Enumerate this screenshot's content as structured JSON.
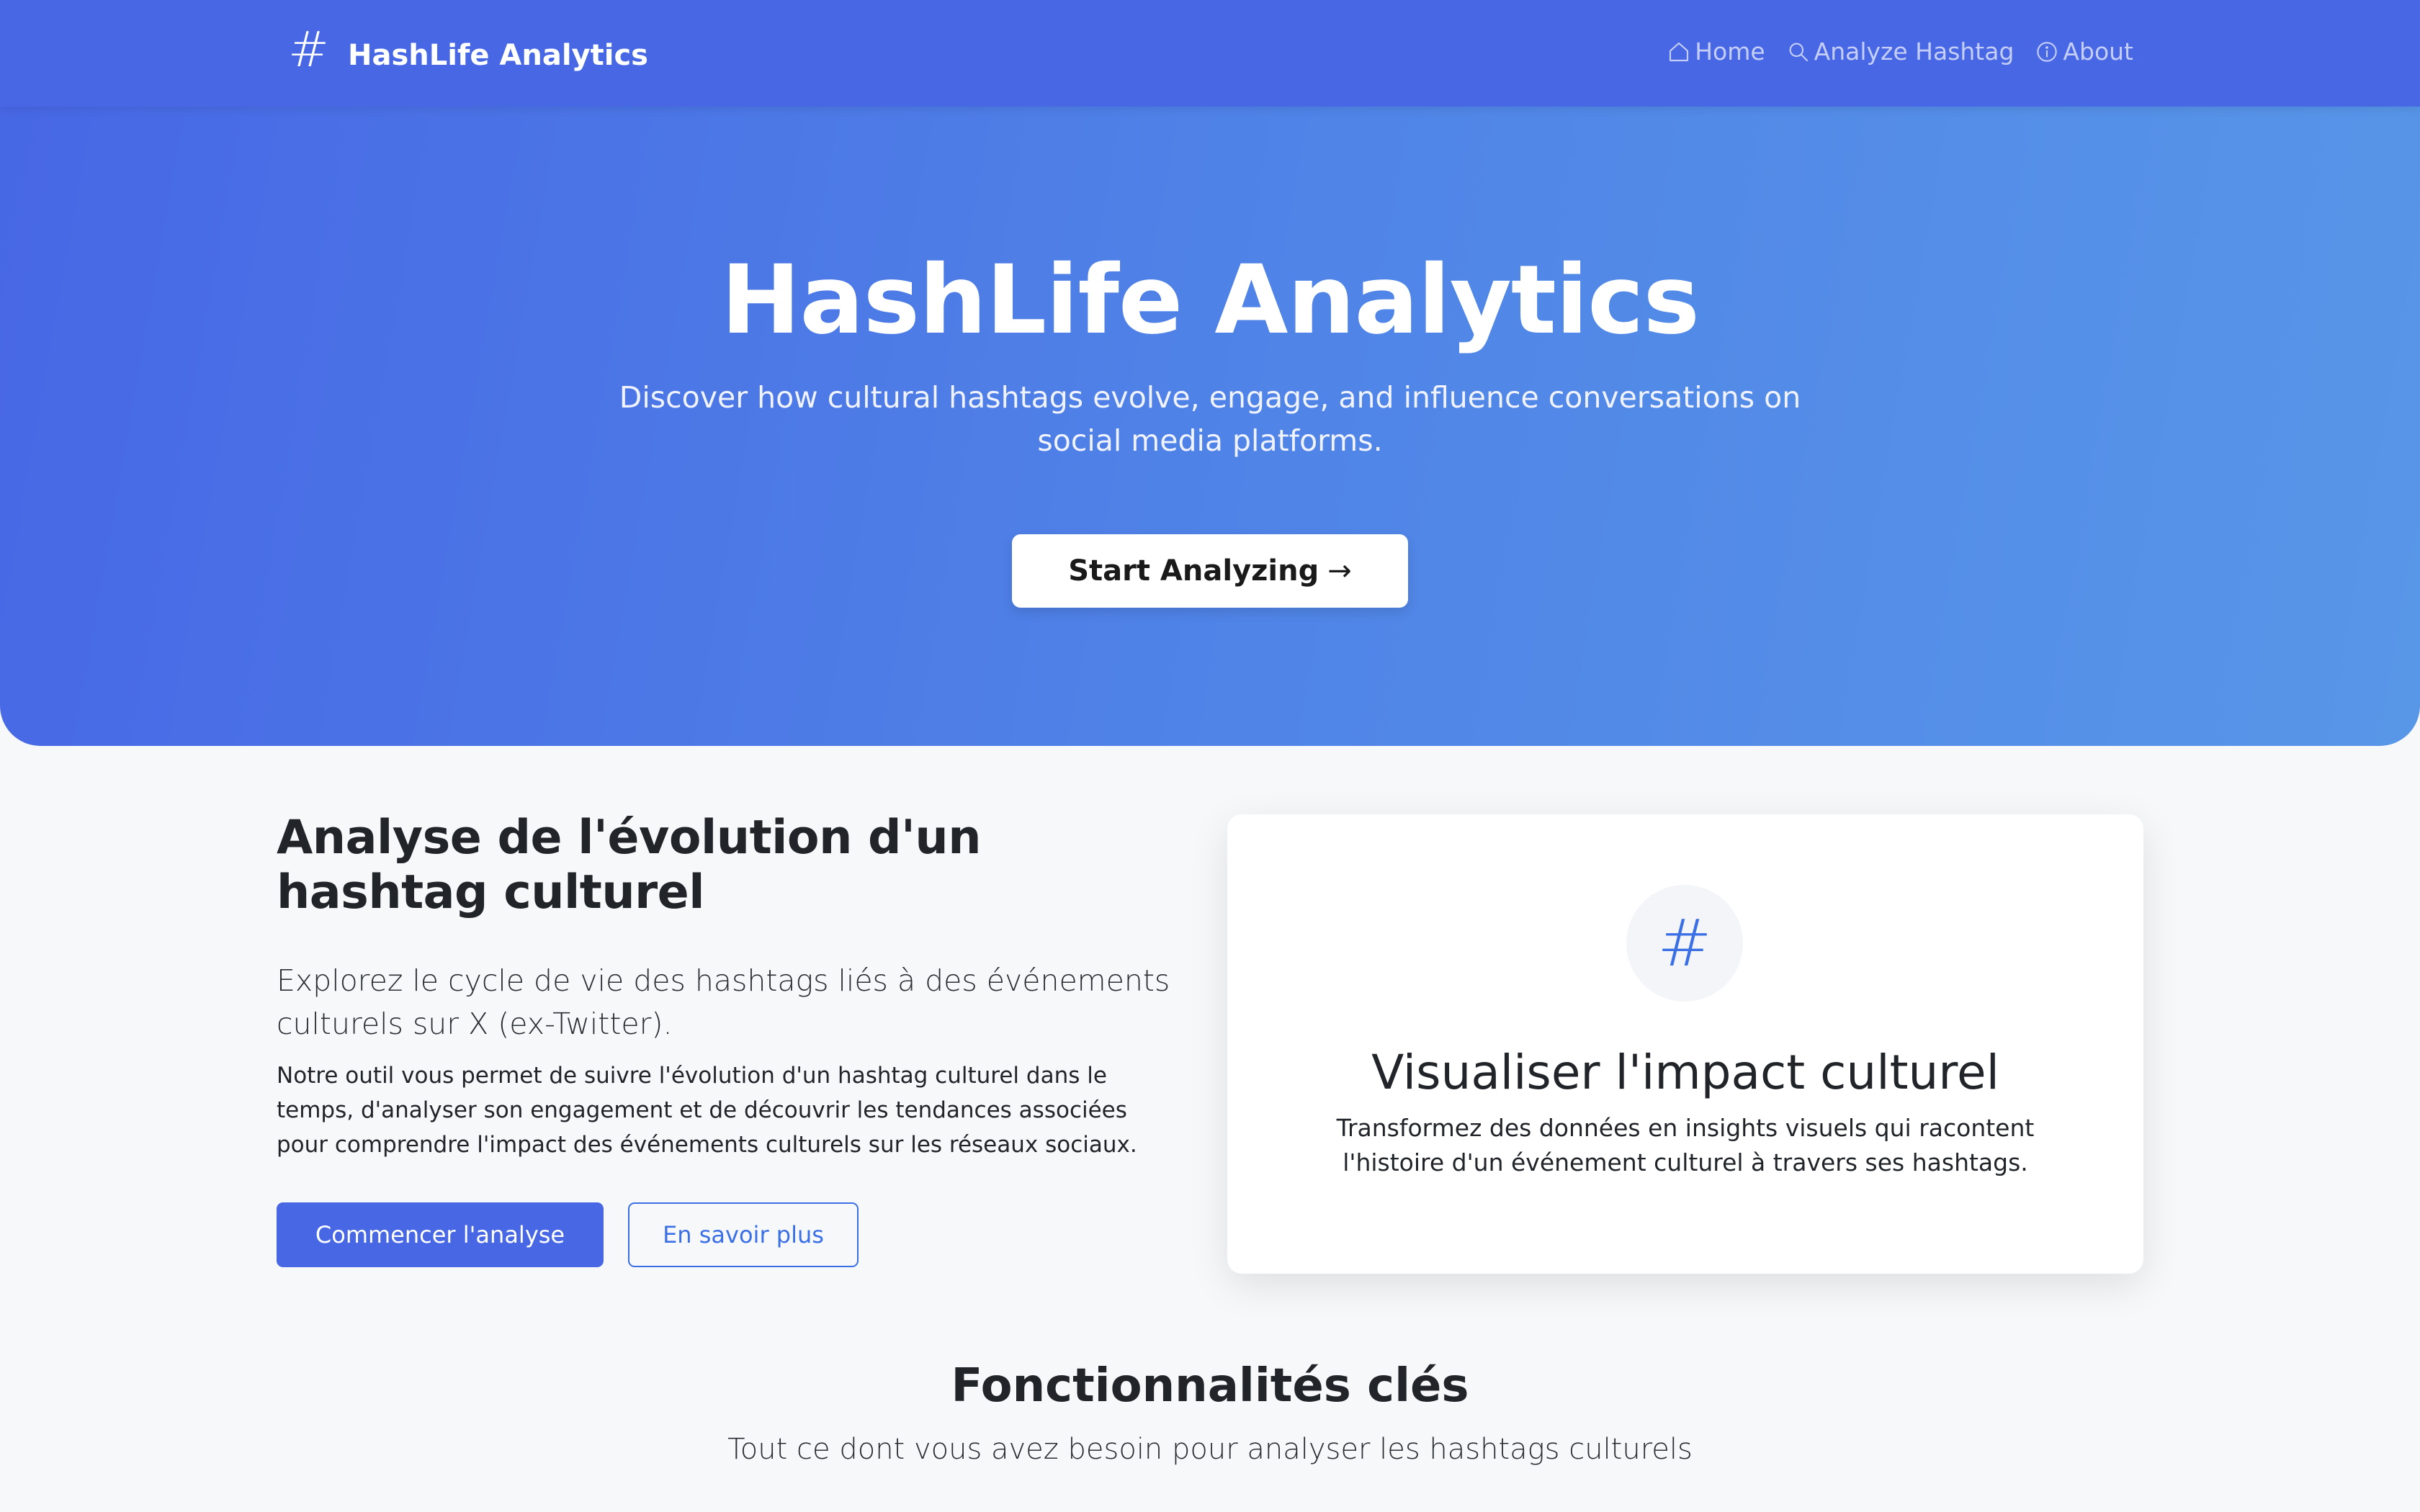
{
  "nav": {
    "brand_icon": "#",
    "brand_name": "HashLife Analytics",
    "links": [
      {
        "label": "Home",
        "icon": "home-icon"
      },
      {
        "label": "Analyze Hashtag",
        "icon": "search-icon"
      },
      {
        "label": "About",
        "icon": "info-icon"
      }
    ]
  },
  "hero": {
    "title": "HashLife Analytics",
    "subtitle": "Discover how cultural hashtags evolve, engage, and influence conversations on social media platforms.",
    "cta_label": "Start Analyzing",
    "cta_arrow": "→"
  },
  "intro": {
    "title": "Analyse de l'évolution d'un hashtag culturel",
    "lead": "Explorez le cycle de vie des hashtags liés à des événements culturels sur X (ex-Twitter).",
    "body": "Notre outil vous permet de suivre l'évolution d'un hashtag culturel dans le temps, d'analyser son engagement et de découvrir les tendances associées pour comprendre l'impact des événements culturels sur les réseaux sociaux.",
    "primary_button": "Commencer l'analyse",
    "secondary_button": "En savoir plus"
  },
  "card": {
    "icon": "#",
    "title": "Visualiser l'impact culturel",
    "text": "Transformez des données en insights visuels qui racontent l'histoire d'un événement culturel à travers ses hashtags."
  },
  "features": {
    "title": "Fonctionnalités clés",
    "subtitle": "Tout ce dont vous avez besoin pour analyser les hashtags culturels"
  },
  "colors": {
    "primary": "#4767e5",
    "accent_blue": "#3a6fe6",
    "page_bg": "#f7f8fa",
    "gradient_end": "#5896e8"
  }
}
